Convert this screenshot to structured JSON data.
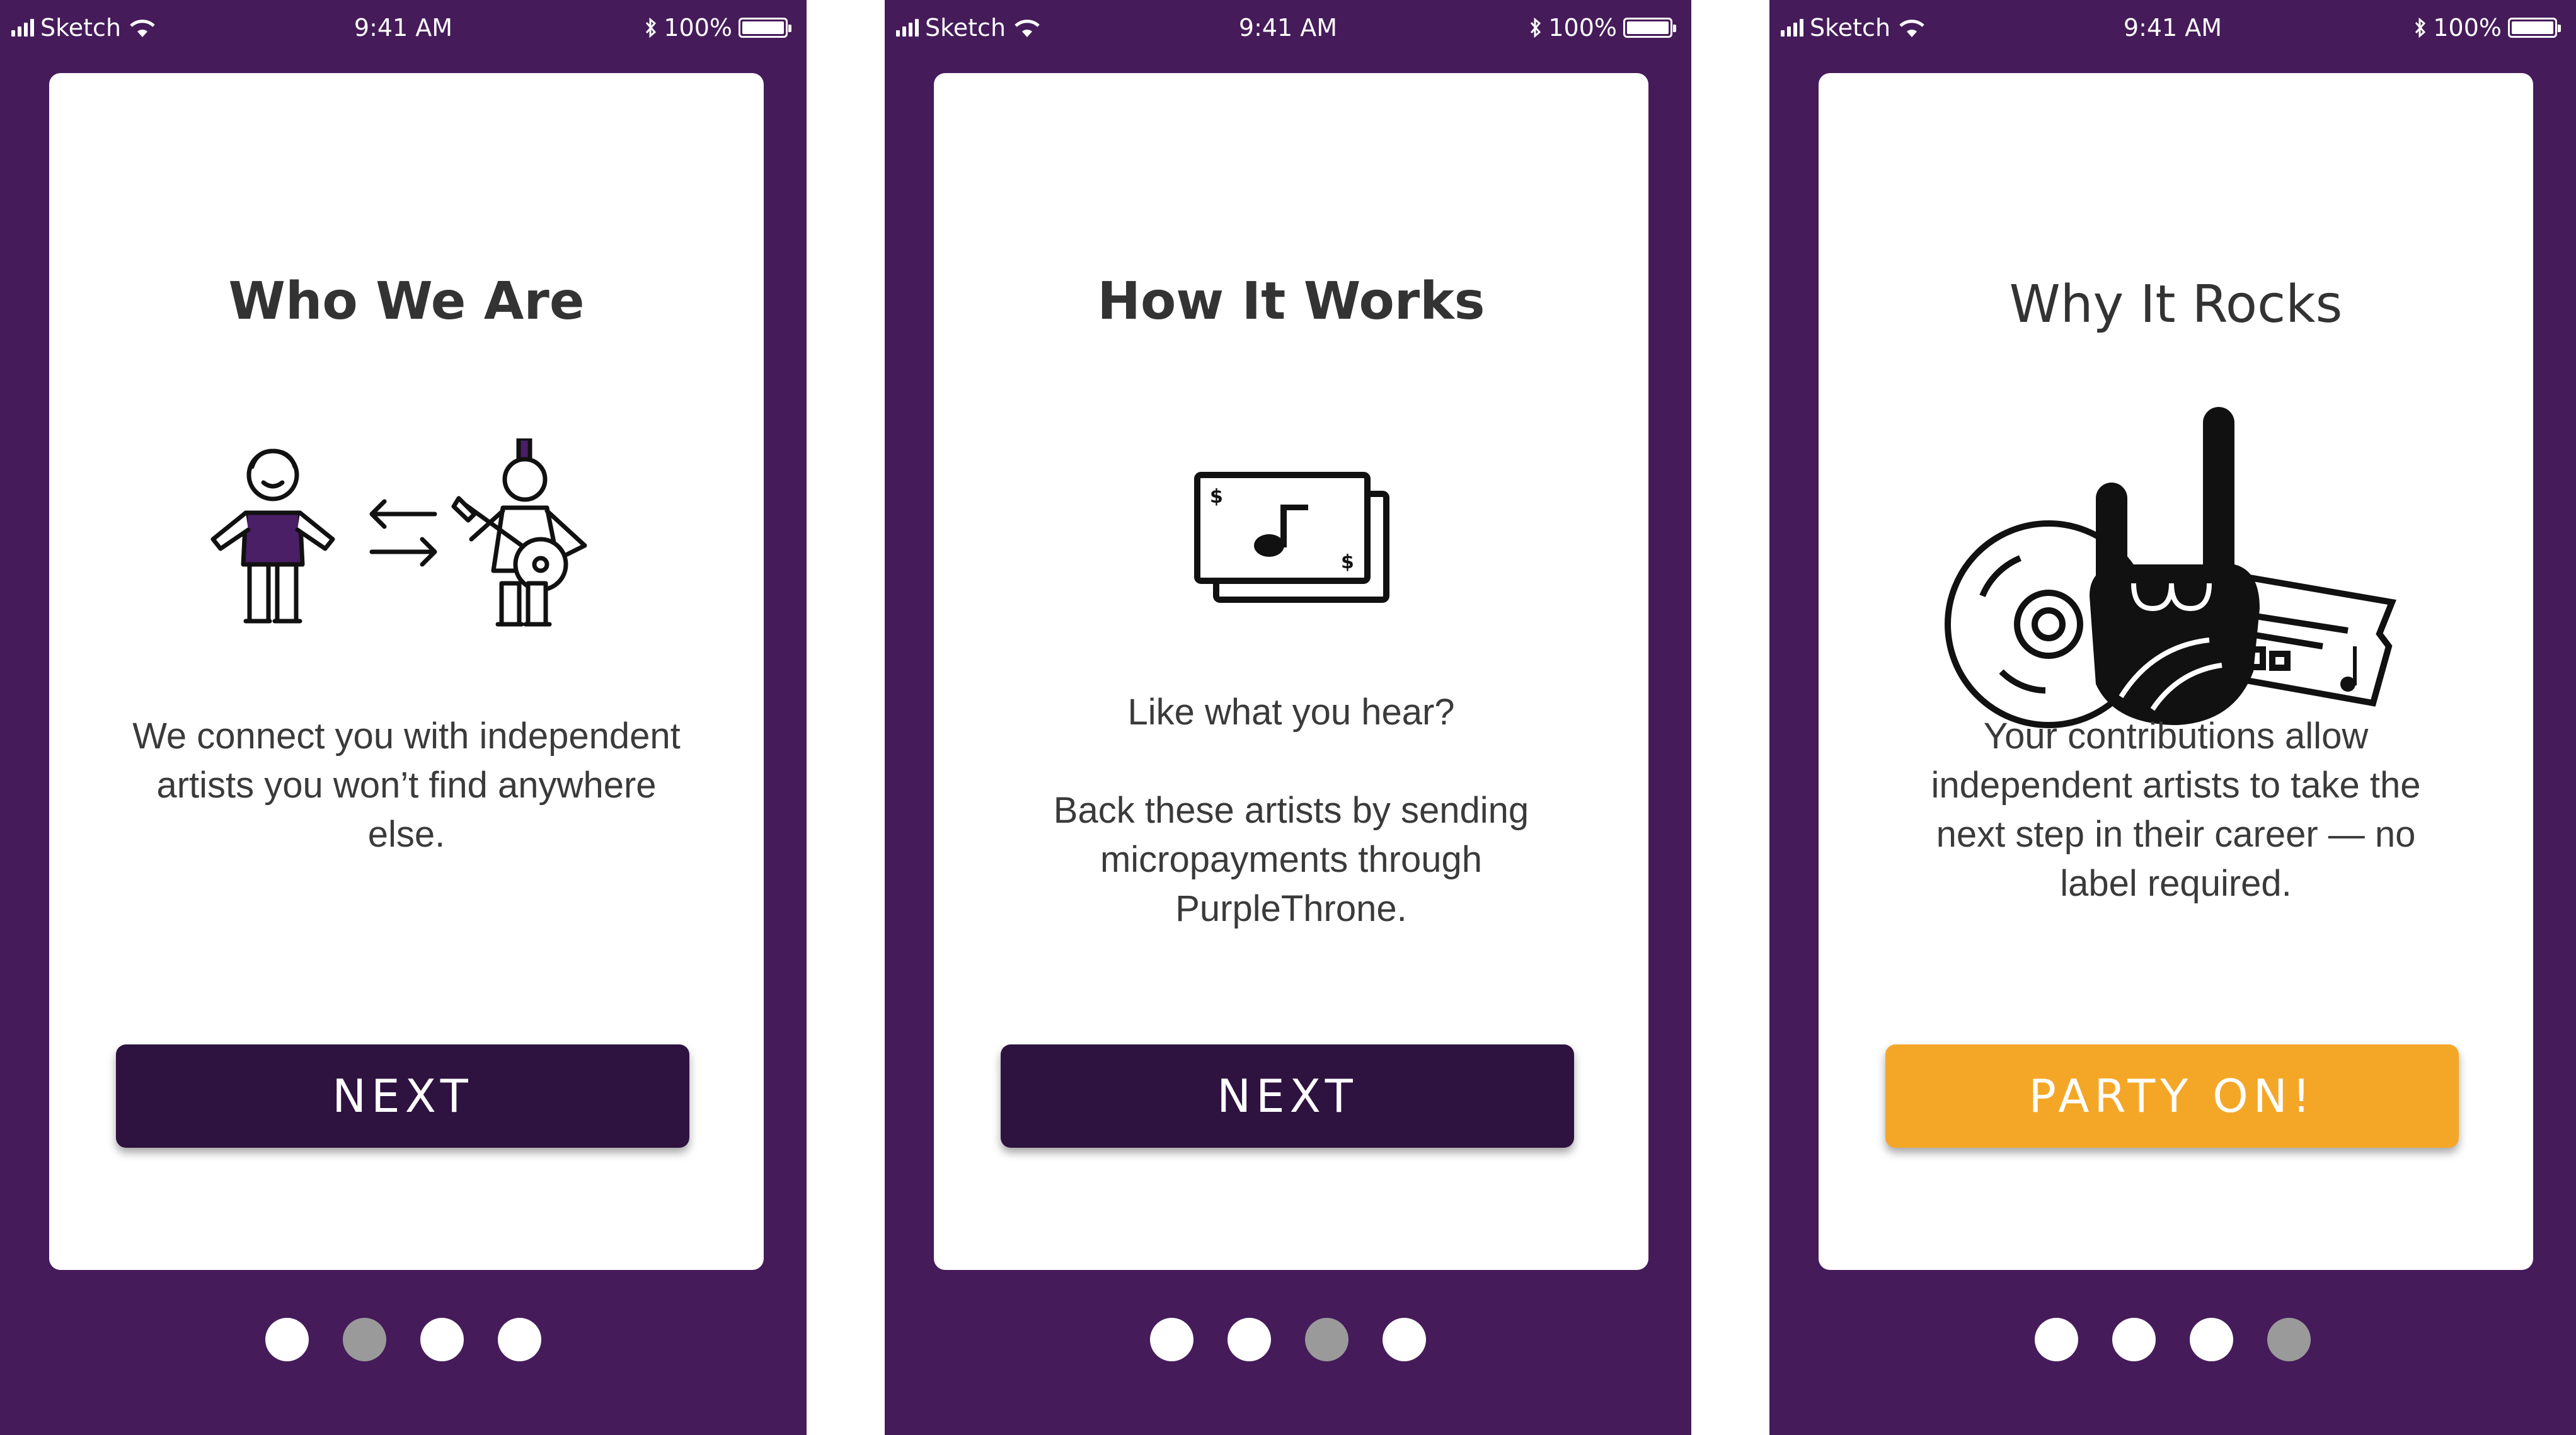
{
  "status_bar": {
    "carrier": "Sketch",
    "time": "9:41 AM",
    "battery": "100%"
  },
  "colors": {
    "background": "#451b5a",
    "button_dark": "#2e1240",
    "button_accent": "#f4a727",
    "dot_active": "#9a9a9a"
  },
  "screens": [
    {
      "title": "Who We Are",
      "illustration_icon": "fan-artist-exchange-icon",
      "body": "We connect you with independent artists you won’t find anywhere else.",
      "button_label": "NEXT",
      "active_dot": 2
    },
    {
      "title": "How It Works",
      "illustration_icon": "money-music-note-icon",
      "body_line1": "Like what you hear?",
      "body_line2": "Back these artists by sending micropayments through PurpleThrone.",
      "button_label": "NEXT",
      "active_dot": 3
    },
    {
      "title": "Why It Rocks",
      "illustration_icon": "record-rock-hand-ticket-icon",
      "body": "Your contributions allow independent artists to take the next step in their career — no label required.",
      "button_label": "PARTY ON!",
      "active_dot": 4
    }
  ],
  "page_dots": 4
}
